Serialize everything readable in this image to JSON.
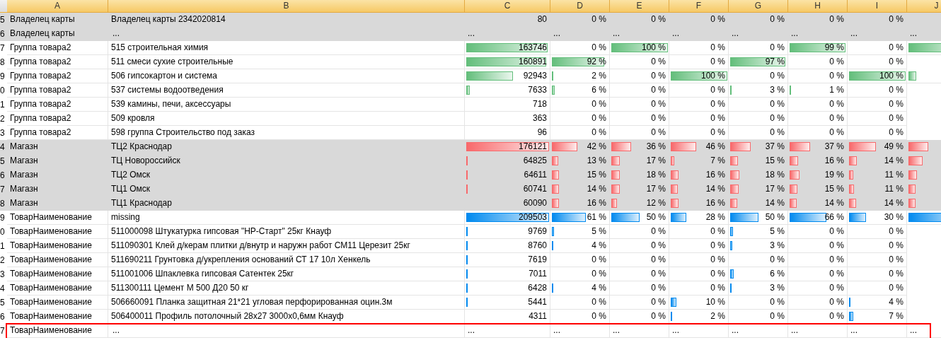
{
  "columns": [
    "A",
    "B",
    "C",
    "D",
    "E",
    "F",
    "G",
    "H",
    "I",
    "J"
  ],
  "rows": [
    {
      "number": "5",
      "kind": "data",
      "shaded": true,
      "a": "Владелец карты",
      "b": "Владелец карты 2342020814",
      "cells": [
        {
          "text": "80"
        },
        {
          "text": "0 %"
        },
        {
          "text": "0 %"
        },
        {
          "text": "0 %"
        },
        {
          "text": "0 %"
        },
        {
          "text": "0 %"
        },
        {
          "text": "0 %"
        }
      ]
    },
    {
      "number": "6",
      "kind": "more",
      "shaded": true,
      "a": "Владелец карты",
      "b": "...",
      "cells": [
        {
          "text": "..."
        },
        {
          "text": "..."
        },
        {
          "text": "..."
        },
        {
          "text": "..."
        },
        {
          "text": "..."
        },
        {
          "text": "..."
        },
        {
          "text": "..."
        },
        {
          "text": "..."
        }
      ]
    },
    {
      "number": "7",
      "kind": "data",
      "shaded": false,
      "color": "#63be7b",
      "a": "Группа товара2",
      "b": "515 строительная химия",
      "cells": [
        {
          "text": "163746",
          "level": 0.98
        },
        {
          "text": "0 %"
        },
        {
          "text": "100 %",
          "level": 1
        },
        {
          "text": "0 %"
        },
        {
          "text": "0 %"
        },
        {
          "text": "99 %",
          "level": 0.99
        },
        {
          "text": "0 %"
        },
        {
          "level": 1
        }
      ]
    },
    {
      "number": "8",
      "kind": "data",
      "shaded": false,
      "color": "#63be7b",
      "a": "Группа товара2",
      "b": "511 смеси сухие строительные",
      "cells": [
        {
          "text": "160891",
          "level": 0.97
        },
        {
          "text": "92 %",
          "level": 0.92
        },
        {
          "text": "0 %"
        },
        {
          "text": "0 %"
        },
        {
          "text": "97 %",
          "level": 0.97
        },
        {
          "text": "0 %"
        },
        {
          "text": "0 %"
        }
      ]
    },
    {
      "number": "9",
      "kind": "data",
      "shaded": false,
      "color": "#63be7b",
      "a": "Группа товара2",
      "b": "506 гипсокартон и система",
      "cells": [
        {
          "text": "92943",
          "level": 0.56
        },
        {
          "text": "2 %",
          "level": 0.01
        },
        {
          "text": "0 %"
        },
        {
          "text": "100 %",
          "level": 1
        },
        {
          "text": "0 %"
        },
        {
          "text": "0 %"
        },
        {
          "text": "100 %",
          "level": 1
        },
        {
          "level": 0.14
        }
      ]
    },
    {
      "number": "0",
      "kind": "data",
      "shaded": false,
      "color": "#63be7b",
      "a": "Группа товара2",
      "b": "537 системы водоотведения",
      "cells": [
        {
          "text": "7633",
          "level": 0.04
        },
        {
          "text": "6 %",
          "level": 0.05
        },
        {
          "text": "0 %"
        },
        {
          "text": "0 %"
        },
        {
          "text": "3 %",
          "level": 0.02
        },
        {
          "text": "1 %",
          "level": 0.01
        },
        {
          "text": "0 %"
        }
      ]
    },
    {
      "number": "1",
      "kind": "data",
      "shaded": false,
      "a": "Группа товара2",
      "b": "539 камины, печи, аксессуары",
      "cells": [
        {
          "text": "718"
        },
        {
          "text": "0 %"
        },
        {
          "text": "0 %"
        },
        {
          "text": "0 %"
        },
        {
          "text": "0 %"
        },
        {
          "text": "0 %"
        },
        {
          "text": "0 %"
        }
      ]
    },
    {
      "number": "2",
      "kind": "data",
      "shaded": false,
      "a": "Группа товара2",
      "b": "509 кровля",
      "cells": [
        {
          "text": "363"
        },
        {
          "text": "0 %"
        },
        {
          "text": "0 %"
        },
        {
          "text": "0 %"
        },
        {
          "text": "0 %"
        },
        {
          "text": "0 %"
        },
        {
          "text": "0 %"
        }
      ]
    },
    {
      "number": "3",
      "kind": "data",
      "shaded": false,
      "a": "Группа товара2",
      "b": "598 группа Строительство под заказ",
      "cells": [
        {
          "text": "96"
        },
        {
          "text": "0 %"
        },
        {
          "text": "0 %"
        },
        {
          "text": "0 %"
        },
        {
          "text": "0 %"
        },
        {
          "text": "0 %"
        },
        {
          "text": "0 %"
        }
      ]
    },
    {
      "number": "4",
      "kind": "data",
      "shaded": true,
      "color": "#f8696b",
      "a": "Магазн",
      "b": "ТЦ2 Краснодар",
      "cells": [
        {
          "text": "176121",
          "level": 1
        },
        {
          "text": "42 %",
          "level": 0.45
        },
        {
          "text": "36 %",
          "level": 0.35
        },
        {
          "text": "46 %",
          "level": 0.45
        },
        {
          "text": "37 %",
          "level": 0.36
        },
        {
          "text": "37 %",
          "level": 0.36
        },
        {
          "text": "49 %",
          "level": 0.48
        },
        {
          "level": 0.35
        }
      ]
    },
    {
      "number": "5",
      "kind": "data",
      "shaded": true,
      "color": "#f8696b",
      "a": "Магазн",
      "b": "ТЦ Новороссийск",
      "cells": [
        {
          "text": "64825",
          "level": 0.02
        },
        {
          "text": "13 %",
          "level": 0.11
        },
        {
          "text": "17 %",
          "level": 0.15
        },
        {
          "text": "7 %",
          "level": 0.06
        },
        {
          "text": "15 %",
          "level": 0.14
        },
        {
          "text": "16 %",
          "level": 0.15
        },
        {
          "text": "14 %",
          "level": 0.14
        },
        {
          "level": 0.25
        }
      ]
    },
    {
      "number": "6",
      "kind": "data",
      "shaded": true,
      "color": "#f8696b",
      "a": "Магазн",
      "b": "ТЦ2 Омск",
      "cells": [
        {
          "text": "64611",
          "level": 0.02
        },
        {
          "text": "15 %",
          "level": 0.13
        },
        {
          "text": "18 %",
          "level": 0.15
        },
        {
          "text": "16 %",
          "level": 0.14
        },
        {
          "text": "18 %",
          "level": 0.16
        },
        {
          "text": "19 %",
          "level": 0.18
        },
        {
          "text": "11 %",
          "level": 0.08
        },
        {
          "level": 0.15
        }
      ]
    },
    {
      "number": "7",
      "kind": "data",
      "shaded": true,
      "color": "#f8696b",
      "a": "Магазн",
      "b": "ТЦ1 Омск",
      "cells": [
        {
          "text": "60741",
          "level": 0.01
        },
        {
          "text": "14 %",
          "level": 0.12
        },
        {
          "text": "17 %",
          "level": 0.15
        },
        {
          "text": "14 %",
          "level": 0.13
        },
        {
          "text": "17 %",
          "level": 0.15
        },
        {
          "text": "15 %",
          "level": 0.14
        },
        {
          "text": "11 %",
          "level": 0.09
        },
        {
          "level": 0.13
        }
      ]
    },
    {
      "number": "8",
      "kind": "data",
      "shaded": true,
      "color": "#f8696b",
      "a": "Магазн",
      "b": "ТЦ1 Краснодар",
      "cells": [
        {
          "text": "60090"
        },
        {
          "text": "16 %",
          "level": 0.13
        },
        {
          "text": "12 %",
          "level": 0.1
        },
        {
          "text": "16 %",
          "level": 0.14
        },
        {
          "text": "14 %",
          "level": 0.12
        },
        {
          "text": "14 %",
          "level": 0.13
        },
        {
          "text": "14 %",
          "level": 0.13
        },
        {
          "level": 0.13
        }
      ]
    },
    {
      "number": "9",
      "kind": "data",
      "shaded": false,
      "color": "#008aef",
      "a": "ТоварНаименование",
      "b": "missing",
      "cells": [
        {
          "text": "209503",
          "level": 1
        },
        {
          "text": "61 %",
          "level": 0.6
        },
        {
          "text": "50 %",
          "level": 0.5
        },
        {
          "text": "28 %",
          "level": 0.28
        },
        {
          "text": "50 %",
          "level": 0.5
        },
        {
          "text": "66 %",
          "level": 0.65
        },
        {
          "text": "30 %",
          "level": 0.3
        },
        {
          "level": 1
        }
      ]
    },
    {
      "number": "0",
      "kind": "data",
      "shaded": false,
      "color": "#008aef",
      "a": "ТоварНаименование",
      "b": "511000098 Штукатурка гипсовая \"НР-Старт\" 25кг Кнауф",
      "cells": [
        {
          "text": "9769",
          "level": 0.02
        },
        {
          "text": "5 %",
          "level": 0.04
        },
        {
          "text": "0 %"
        },
        {
          "text": "0 %"
        },
        {
          "text": "5 %",
          "level": 0.05
        },
        {
          "text": "0 %"
        },
        {
          "text": "0 %"
        }
      ]
    },
    {
      "number": "1",
      "kind": "data",
      "shaded": false,
      "color": "#008aef",
      "a": "ТоварНаименование",
      "b": "511090301 Клей д/керам плитки д/внутр и наружн работ СМ11 Церезит 25кг",
      "cells": [
        {
          "text": "8760",
          "level": 0.02
        },
        {
          "text": "4 %",
          "level": 0.03
        },
        {
          "text": "0 %"
        },
        {
          "text": "0 %"
        },
        {
          "text": "3 %",
          "level": 0.04
        },
        {
          "text": "0 %"
        },
        {
          "text": "0 %"
        }
      ]
    },
    {
      "number": "2",
      "kind": "data",
      "shaded": false,
      "color": "#008aef",
      "a": "ТоварНаименование",
      "b": "511690211 Грунтовка д/укрепления оснований СТ 17 10л Хенкель",
      "cells": [
        {
          "text": "7619",
          "level": 0.01
        },
        {
          "text": "0 %"
        },
        {
          "text": "0 %"
        },
        {
          "text": "0 %"
        },
        {
          "text": "0 %"
        },
        {
          "text": "0 %"
        },
        {
          "text": "0 %"
        }
      ]
    },
    {
      "number": "3",
      "kind": "data",
      "shaded": false,
      "color": "#008aef",
      "a": "ТоварНаименование",
      "b": "511001006 Шпаклевка гипсовая Сатентек 25кг",
      "cells": [
        {
          "text": "7011",
          "level": 0.01
        },
        {
          "text": "0 %"
        },
        {
          "text": "0 %"
        },
        {
          "text": "0 %"
        },
        {
          "text": "6 %",
          "level": 0.06
        },
        {
          "text": "0 %"
        },
        {
          "text": "0 %"
        }
      ]
    },
    {
      "number": "4",
      "kind": "data",
      "shaded": false,
      "color": "#008aef",
      "a": "ТоварНаименование",
      "b": "511300111 Цемент М 500 Д20 50 кг",
      "cells": [
        {
          "text": "6428",
          "level": 0.01
        },
        {
          "text": "4 %",
          "level": 0.03
        },
        {
          "text": "0 %"
        },
        {
          "text": "0 %"
        },
        {
          "text": "3 %",
          "level": 0.02
        },
        {
          "text": "0 %"
        },
        {
          "text": "0 %"
        }
      ]
    },
    {
      "number": "5",
      "kind": "data",
      "shaded": false,
      "color": "#008aef",
      "a": "ТоварНаименование",
      "b": "506660091 Планка защитная 21*21 угловая перфорированная оцин.3м",
      "cells": [
        {
          "text": "5441",
          "level": 0.01
        },
        {
          "text": "0 %"
        },
        {
          "text": "0 %"
        },
        {
          "text": "10 %",
          "level": 0.1
        },
        {
          "text": "0 %"
        },
        {
          "text": "0 %"
        },
        {
          "text": "4 %",
          "level": 0.03
        }
      ]
    },
    {
      "number": "6",
      "kind": "data",
      "shaded": false,
      "color": "#008aef",
      "a": "ТоварНаименование",
      "b": "506400011 Профиль потолочный 28x27 3000x0,6мм Кнауф",
      "cells": [
        {
          "text": "4311"
        },
        {
          "text": "0 %"
        },
        {
          "text": "0 %"
        },
        {
          "text": "2 %",
          "level": 0.02
        },
        {
          "text": "0 %"
        },
        {
          "text": "0 %"
        },
        {
          "text": "7 %",
          "level": 0.07
        }
      ]
    },
    {
      "number": "7",
      "kind": "more",
      "shaded": false,
      "highlighted": true,
      "a": "ТоварНаименование",
      "b": "...",
      "cells": [
        {
          "text": "..."
        },
        {
          "text": "..."
        },
        {
          "text": "..."
        },
        {
          "text": "..."
        },
        {
          "text": "..."
        },
        {
          "text": "..."
        },
        {
          "text": "..."
        },
        {
          "text": "..."
        }
      ]
    }
  ]
}
